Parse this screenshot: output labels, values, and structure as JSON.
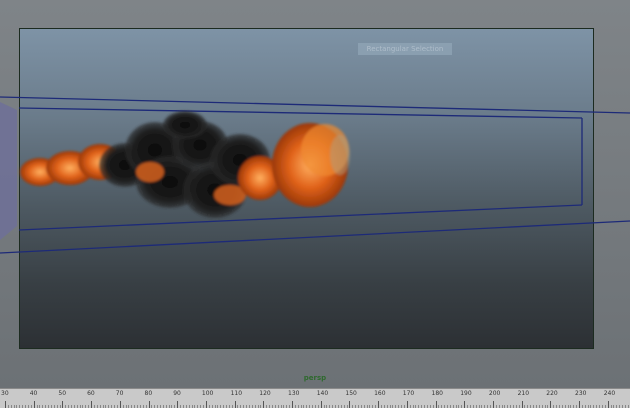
{
  "viewport": {
    "hud_label": "Rectangular Selection",
    "camera_name": "persp"
  },
  "colors": {
    "bounding_box": "#1d2a78",
    "gate_border": "#1c2b20",
    "fire": "#e0621a",
    "smoke": "#1a1a1a"
  },
  "timeline": {
    "ticks": [
      "30",
      "40",
      "50",
      "60",
      "70",
      "80",
      "90",
      "100",
      "110",
      "120",
      "130",
      "140",
      "150",
      "160",
      "170",
      "180",
      "190",
      "200",
      "210",
      "220",
      "230",
      "240"
    ]
  }
}
